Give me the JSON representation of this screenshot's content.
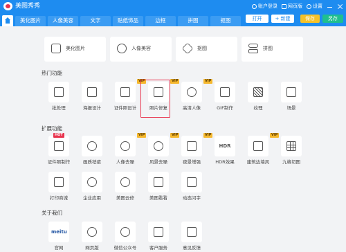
{
  "app": {
    "title": "美图秀秀"
  },
  "titlebar": {
    "account": "账户登录",
    "web_version": "网页版",
    "settings": "设置"
  },
  "tabs": [
    "美化图片",
    "人像美容",
    "文字",
    "贴纸饰品",
    "边框",
    "拼图",
    "抠图"
  ],
  "tab_actions": {
    "open": "打开",
    "new": "+ 新建",
    "save": "保存",
    "save_as": "另存"
  },
  "top_cards": [
    {
      "label": "美化图片",
      "icon": "image-icon"
    },
    {
      "label": "人像美容",
      "icon": "face-icon"
    },
    {
      "label": "抠图",
      "icon": "cutout-icon"
    },
    {
      "label": "拼图",
      "icon": "collage-icon"
    }
  ],
  "sections": {
    "hot": {
      "title": "热门功能",
      "items": [
        {
          "label": "批处理",
          "icon": "batch-icon",
          "badge": ""
        },
        {
          "label": "海报设计",
          "icon": "poster-icon",
          "badge": ""
        },
        {
          "label": "证件照设计",
          "icon": "id-photo-icon",
          "badge": "VIP"
        },
        {
          "label": "照片修复",
          "icon": "photo-repair-icon",
          "badge": "VIP"
        },
        {
          "label": "高清人像",
          "icon": "hd-portrait-icon",
          "badge": "VIP"
        },
        {
          "label": "GIF制作",
          "icon": "gif-icon",
          "badge": ""
        },
        {
          "label": "纹理",
          "icon": "texture-icon",
          "badge": ""
        },
        {
          "label": "场景",
          "icon": "scene-icon",
          "badge": ""
        }
      ]
    },
    "ext": {
      "title": "扩展功能",
      "row1": [
        {
          "label": "证件照制作",
          "icon": "id-camera-icon",
          "badge": "HOT"
        },
        {
          "label": "画质祛痘",
          "icon": "acne-icon",
          "badge": ""
        },
        {
          "label": "人像去噪",
          "icon": "denoise-icon",
          "badge": "VIP"
        },
        {
          "label": "风景去噪",
          "icon": "landscape-denoise-icon",
          "badge": "VIP"
        },
        {
          "label": "夜景增强",
          "icon": "night-icon",
          "badge": "VIP"
        },
        {
          "label": "HDR效果",
          "icon": "hdr-icon",
          "badge": ""
        },
        {
          "label": "建筑边墙风",
          "icon": "building-icon",
          "badge": "VIP"
        },
        {
          "label": "九格切图",
          "icon": "grid-icon",
          "badge": ""
        }
      ],
      "row2": [
        {
          "label": "打印商城",
          "icon": "print-icon",
          "badge": ""
        },
        {
          "label": "企业应用",
          "icon": "enterprise-icon",
          "badge": ""
        },
        {
          "label": "美图云修",
          "icon": "cloud-icon",
          "badge": ""
        },
        {
          "label": "美图看看",
          "icon": "viewer-icon",
          "badge": ""
        },
        {
          "label": "动态闪字",
          "icon": "flash-text-icon",
          "badge": ""
        }
      ]
    },
    "about": {
      "title": "关于我们",
      "items": [
        {
          "label": "官网",
          "icon": "meitu-logo-icon",
          "badge": "",
          "mark": "meitu"
        },
        {
          "label": "网页版",
          "icon": "web-icon",
          "badge": ""
        },
        {
          "label": "微信公众号",
          "icon": "wechat-icon",
          "badge": ""
        },
        {
          "label": "客户服务",
          "icon": "phone-icon",
          "badge": ""
        },
        {
          "label": "意见反馈",
          "icon": "mail-icon",
          "badge": ""
        }
      ]
    }
  },
  "selected_item": "照片修复",
  "colors": {
    "brand_blue": "#1e8cf0",
    "vip": "#f5b82e",
    "hot": "#e8344e",
    "selection": "#e8344e"
  }
}
